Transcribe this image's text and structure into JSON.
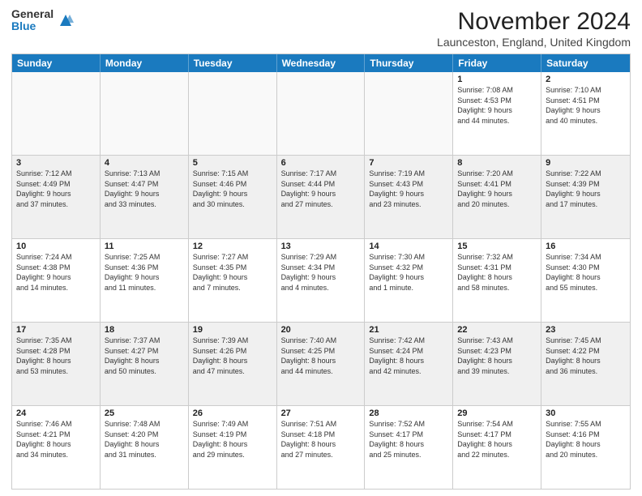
{
  "logo": {
    "general": "General",
    "blue": "Blue"
  },
  "title": "November 2024",
  "location": "Launceston, England, United Kingdom",
  "header_days": [
    "Sunday",
    "Monday",
    "Tuesday",
    "Wednesday",
    "Thursday",
    "Friday",
    "Saturday"
  ],
  "weeks": [
    [
      {
        "day": "",
        "info": "",
        "empty": true
      },
      {
        "day": "",
        "info": "",
        "empty": true
      },
      {
        "day": "",
        "info": "",
        "empty": true
      },
      {
        "day": "",
        "info": "",
        "empty": true
      },
      {
        "day": "",
        "info": "",
        "empty": true
      },
      {
        "day": "1",
        "info": "Sunrise: 7:08 AM\nSunset: 4:53 PM\nDaylight: 9 hours\nand 44 minutes.",
        "empty": false
      },
      {
        "day": "2",
        "info": "Sunrise: 7:10 AM\nSunset: 4:51 PM\nDaylight: 9 hours\nand 40 minutes.",
        "empty": false
      }
    ],
    [
      {
        "day": "3",
        "info": "Sunrise: 7:12 AM\nSunset: 4:49 PM\nDaylight: 9 hours\nand 37 minutes.",
        "empty": false
      },
      {
        "day": "4",
        "info": "Sunrise: 7:13 AM\nSunset: 4:47 PM\nDaylight: 9 hours\nand 33 minutes.",
        "empty": false
      },
      {
        "day": "5",
        "info": "Sunrise: 7:15 AM\nSunset: 4:46 PM\nDaylight: 9 hours\nand 30 minutes.",
        "empty": false
      },
      {
        "day": "6",
        "info": "Sunrise: 7:17 AM\nSunset: 4:44 PM\nDaylight: 9 hours\nand 27 minutes.",
        "empty": false
      },
      {
        "day": "7",
        "info": "Sunrise: 7:19 AM\nSunset: 4:43 PM\nDaylight: 9 hours\nand 23 minutes.",
        "empty": false
      },
      {
        "day": "8",
        "info": "Sunrise: 7:20 AM\nSunset: 4:41 PM\nDaylight: 9 hours\nand 20 minutes.",
        "empty": false
      },
      {
        "day": "9",
        "info": "Sunrise: 7:22 AM\nSunset: 4:39 PM\nDaylight: 9 hours\nand 17 minutes.",
        "empty": false
      }
    ],
    [
      {
        "day": "10",
        "info": "Sunrise: 7:24 AM\nSunset: 4:38 PM\nDaylight: 9 hours\nand 14 minutes.",
        "empty": false
      },
      {
        "day": "11",
        "info": "Sunrise: 7:25 AM\nSunset: 4:36 PM\nDaylight: 9 hours\nand 11 minutes.",
        "empty": false
      },
      {
        "day": "12",
        "info": "Sunrise: 7:27 AM\nSunset: 4:35 PM\nDaylight: 9 hours\nand 7 minutes.",
        "empty": false
      },
      {
        "day": "13",
        "info": "Sunrise: 7:29 AM\nSunset: 4:34 PM\nDaylight: 9 hours\nand 4 minutes.",
        "empty": false
      },
      {
        "day": "14",
        "info": "Sunrise: 7:30 AM\nSunset: 4:32 PM\nDaylight: 9 hours\nand 1 minute.",
        "empty": false
      },
      {
        "day": "15",
        "info": "Sunrise: 7:32 AM\nSunset: 4:31 PM\nDaylight: 8 hours\nand 58 minutes.",
        "empty": false
      },
      {
        "day": "16",
        "info": "Sunrise: 7:34 AM\nSunset: 4:30 PM\nDaylight: 8 hours\nand 55 minutes.",
        "empty": false
      }
    ],
    [
      {
        "day": "17",
        "info": "Sunrise: 7:35 AM\nSunset: 4:28 PM\nDaylight: 8 hours\nand 53 minutes.",
        "empty": false
      },
      {
        "day": "18",
        "info": "Sunrise: 7:37 AM\nSunset: 4:27 PM\nDaylight: 8 hours\nand 50 minutes.",
        "empty": false
      },
      {
        "day": "19",
        "info": "Sunrise: 7:39 AM\nSunset: 4:26 PM\nDaylight: 8 hours\nand 47 minutes.",
        "empty": false
      },
      {
        "day": "20",
        "info": "Sunrise: 7:40 AM\nSunset: 4:25 PM\nDaylight: 8 hours\nand 44 minutes.",
        "empty": false
      },
      {
        "day": "21",
        "info": "Sunrise: 7:42 AM\nSunset: 4:24 PM\nDaylight: 8 hours\nand 42 minutes.",
        "empty": false
      },
      {
        "day": "22",
        "info": "Sunrise: 7:43 AM\nSunset: 4:23 PM\nDaylight: 8 hours\nand 39 minutes.",
        "empty": false
      },
      {
        "day": "23",
        "info": "Sunrise: 7:45 AM\nSunset: 4:22 PM\nDaylight: 8 hours\nand 36 minutes.",
        "empty": false
      }
    ],
    [
      {
        "day": "24",
        "info": "Sunrise: 7:46 AM\nSunset: 4:21 PM\nDaylight: 8 hours\nand 34 minutes.",
        "empty": false
      },
      {
        "day": "25",
        "info": "Sunrise: 7:48 AM\nSunset: 4:20 PM\nDaylight: 8 hours\nand 31 minutes.",
        "empty": false
      },
      {
        "day": "26",
        "info": "Sunrise: 7:49 AM\nSunset: 4:19 PM\nDaylight: 8 hours\nand 29 minutes.",
        "empty": false
      },
      {
        "day": "27",
        "info": "Sunrise: 7:51 AM\nSunset: 4:18 PM\nDaylight: 8 hours\nand 27 minutes.",
        "empty": false
      },
      {
        "day": "28",
        "info": "Sunrise: 7:52 AM\nSunset: 4:17 PM\nDaylight: 8 hours\nand 25 minutes.",
        "empty": false
      },
      {
        "day": "29",
        "info": "Sunrise: 7:54 AM\nSunset: 4:17 PM\nDaylight: 8 hours\nand 22 minutes.",
        "empty": false
      },
      {
        "day": "30",
        "info": "Sunrise: 7:55 AM\nSunset: 4:16 PM\nDaylight: 8 hours\nand 20 minutes.",
        "empty": false
      }
    ]
  ]
}
